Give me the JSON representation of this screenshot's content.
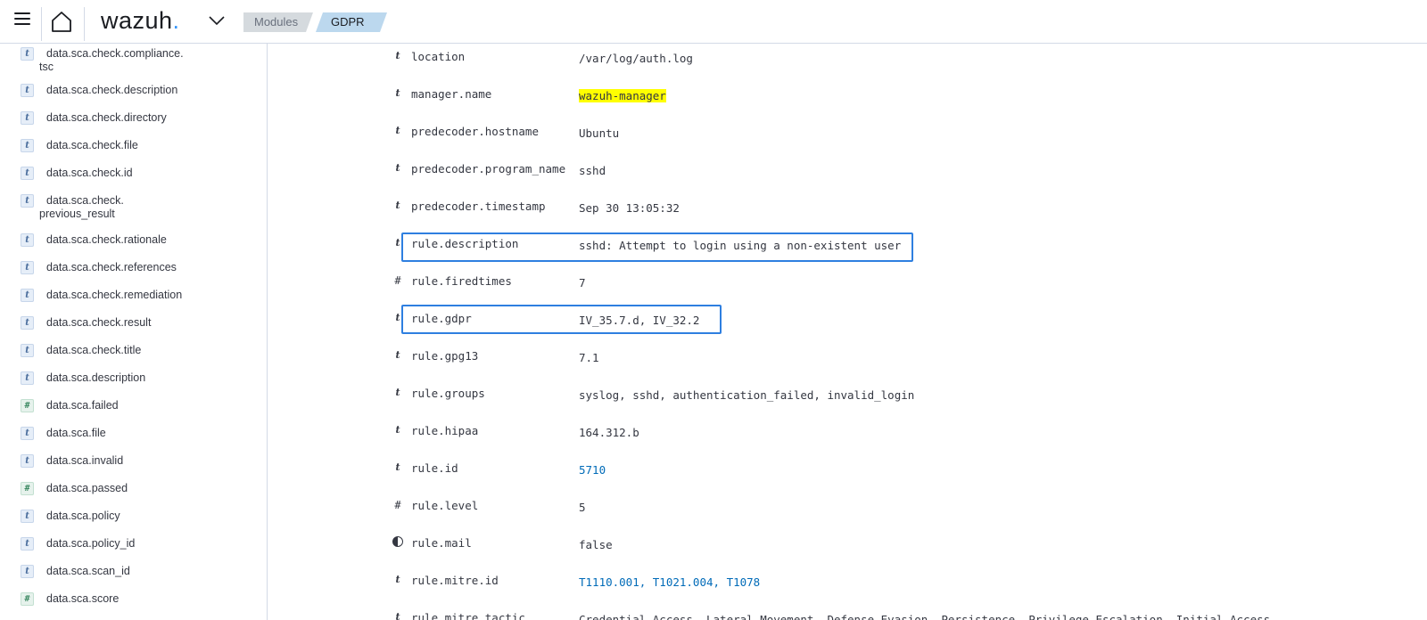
{
  "header": {
    "logo_text": "wazuh",
    "logo_dot": ".",
    "breadcrumbs": [
      {
        "label": "Modules"
      },
      {
        "label": "GDPR",
        "info_icon": "i"
      }
    ]
  },
  "sidebar": {
    "items": [
      {
        "type": "t",
        "label": "data.sca.check.compliance.",
        "label2": "tsc"
      },
      {
        "type": "t",
        "label": "data.sca.check.description"
      },
      {
        "type": "t",
        "label": "data.sca.check.directory"
      },
      {
        "type": "t",
        "label": "data.sca.check.file"
      },
      {
        "type": "t",
        "label": "data.sca.check.id"
      },
      {
        "type": "t",
        "label": "data.sca.check.",
        "label2": "previous_result"
      },
      {
        "type": "t",
        "label": "data.sca.check.rationale"
      },
      {
        "type": "t",
        "label": "data.sca.check.references"
      },
      {
        "type": "t",
        "label": "data.sca.check.remediation"
      },
      {
        "type": "t",
        "label": "data.sca.check.result"
      },
      {
        "type": "t",
        "label": "data.sca.check.title"
      },
      {
        "type": "t",
        "label": "data.sca.description"
      },
      {
        "type": "#",
        "label": "data.sca.failed"
      },
      {
        "type": "t",
        "label": "data.sca.file"
      },
      {
        "type": "t",
        "label": "data.sca.invalid"
      },
      {
        "type": "#",
        "label": "data.sca.passed"
      },
      {
        "type": "t",
        "label": "data.sca.policy"
      },
      {
        "type": "t",
        "label": "data.sca.policy_id"
      },
      {
        "type": "t",
        "label": "data.sca.scan_id"
      },
      {
        "type": "#",
        "label": "data.sca.score"
      }
    ]
  },
  "document": {
    "rows": [
      {
        "type": "t",
        "field": "location",
        "value": "/var/log/auth.log"
      },
      {
        "type": "t",
        "field": "manager.name",
        "value": "wazuh-manager",
        "highlight": true
      },
      {
        "type": "t",
        "field": "predecoder.hostname",
        "value": "Ubuntu"
      },
      {
        "type": "t",
        "field": "predecoder.program_name",
        "value": "sshd"
      },
      {
        "type": "t",
        "field": "predecoder.timestamp",
        "value": "Sep 30 13:05:32"
      },
      {
        "type": "t",
        "field": "rule.description",
        "value": "sshd: Attempt to login using a non-existent user"
      },
      {
        "type": "#",
        "field": "rule.firedtimes",
        "value": "7"
      },
      {
        "type": "t",
        "field": "rule.gdpr",
        "value": "IV_35.7.d, IV_32.2"
      },
      {
        "type": "t",
        "field": "rule.gpg13",
        "value": "7.1"
      },
      {
        "type": "t",
        "field": "rule.groups",
        "value": "syslog, sshd, authentication_failed, invalid_login"
      },
      {
        "type": "t",
        "field": "rule.hipaa",
        "value": "164.312.b"
      },
      {
        "type": "t",
        "field": "rule.id",
        "value": "5710",
        "link": true
      },
      {
        "type": "#",
        "field": "rule.level",
        "value": "5"
      },
      {
        "type": "bool",
        "field": "rule.mail",
        "value": "false"
      },
      {
        "type": "t",
        "field": "rule.mitre.id",
        "value": "T1110.001, T1021.004, T1078",
        "link": true
      },
      {
        "type": "t",
        "field": "rule.mitre.tactic",
        "value": "Credential Access, Lateral Movement, Defense Evasion, Persistence, Privilege Escalation, Initial Access"
      }
    ]
  },
  "colors": {
    "highlight": "#ffff00",
    "annotation_box": "#2e7fe0",
    "link": "#006bb8",
    "logo_dot": "#3595f9"
  }
}
